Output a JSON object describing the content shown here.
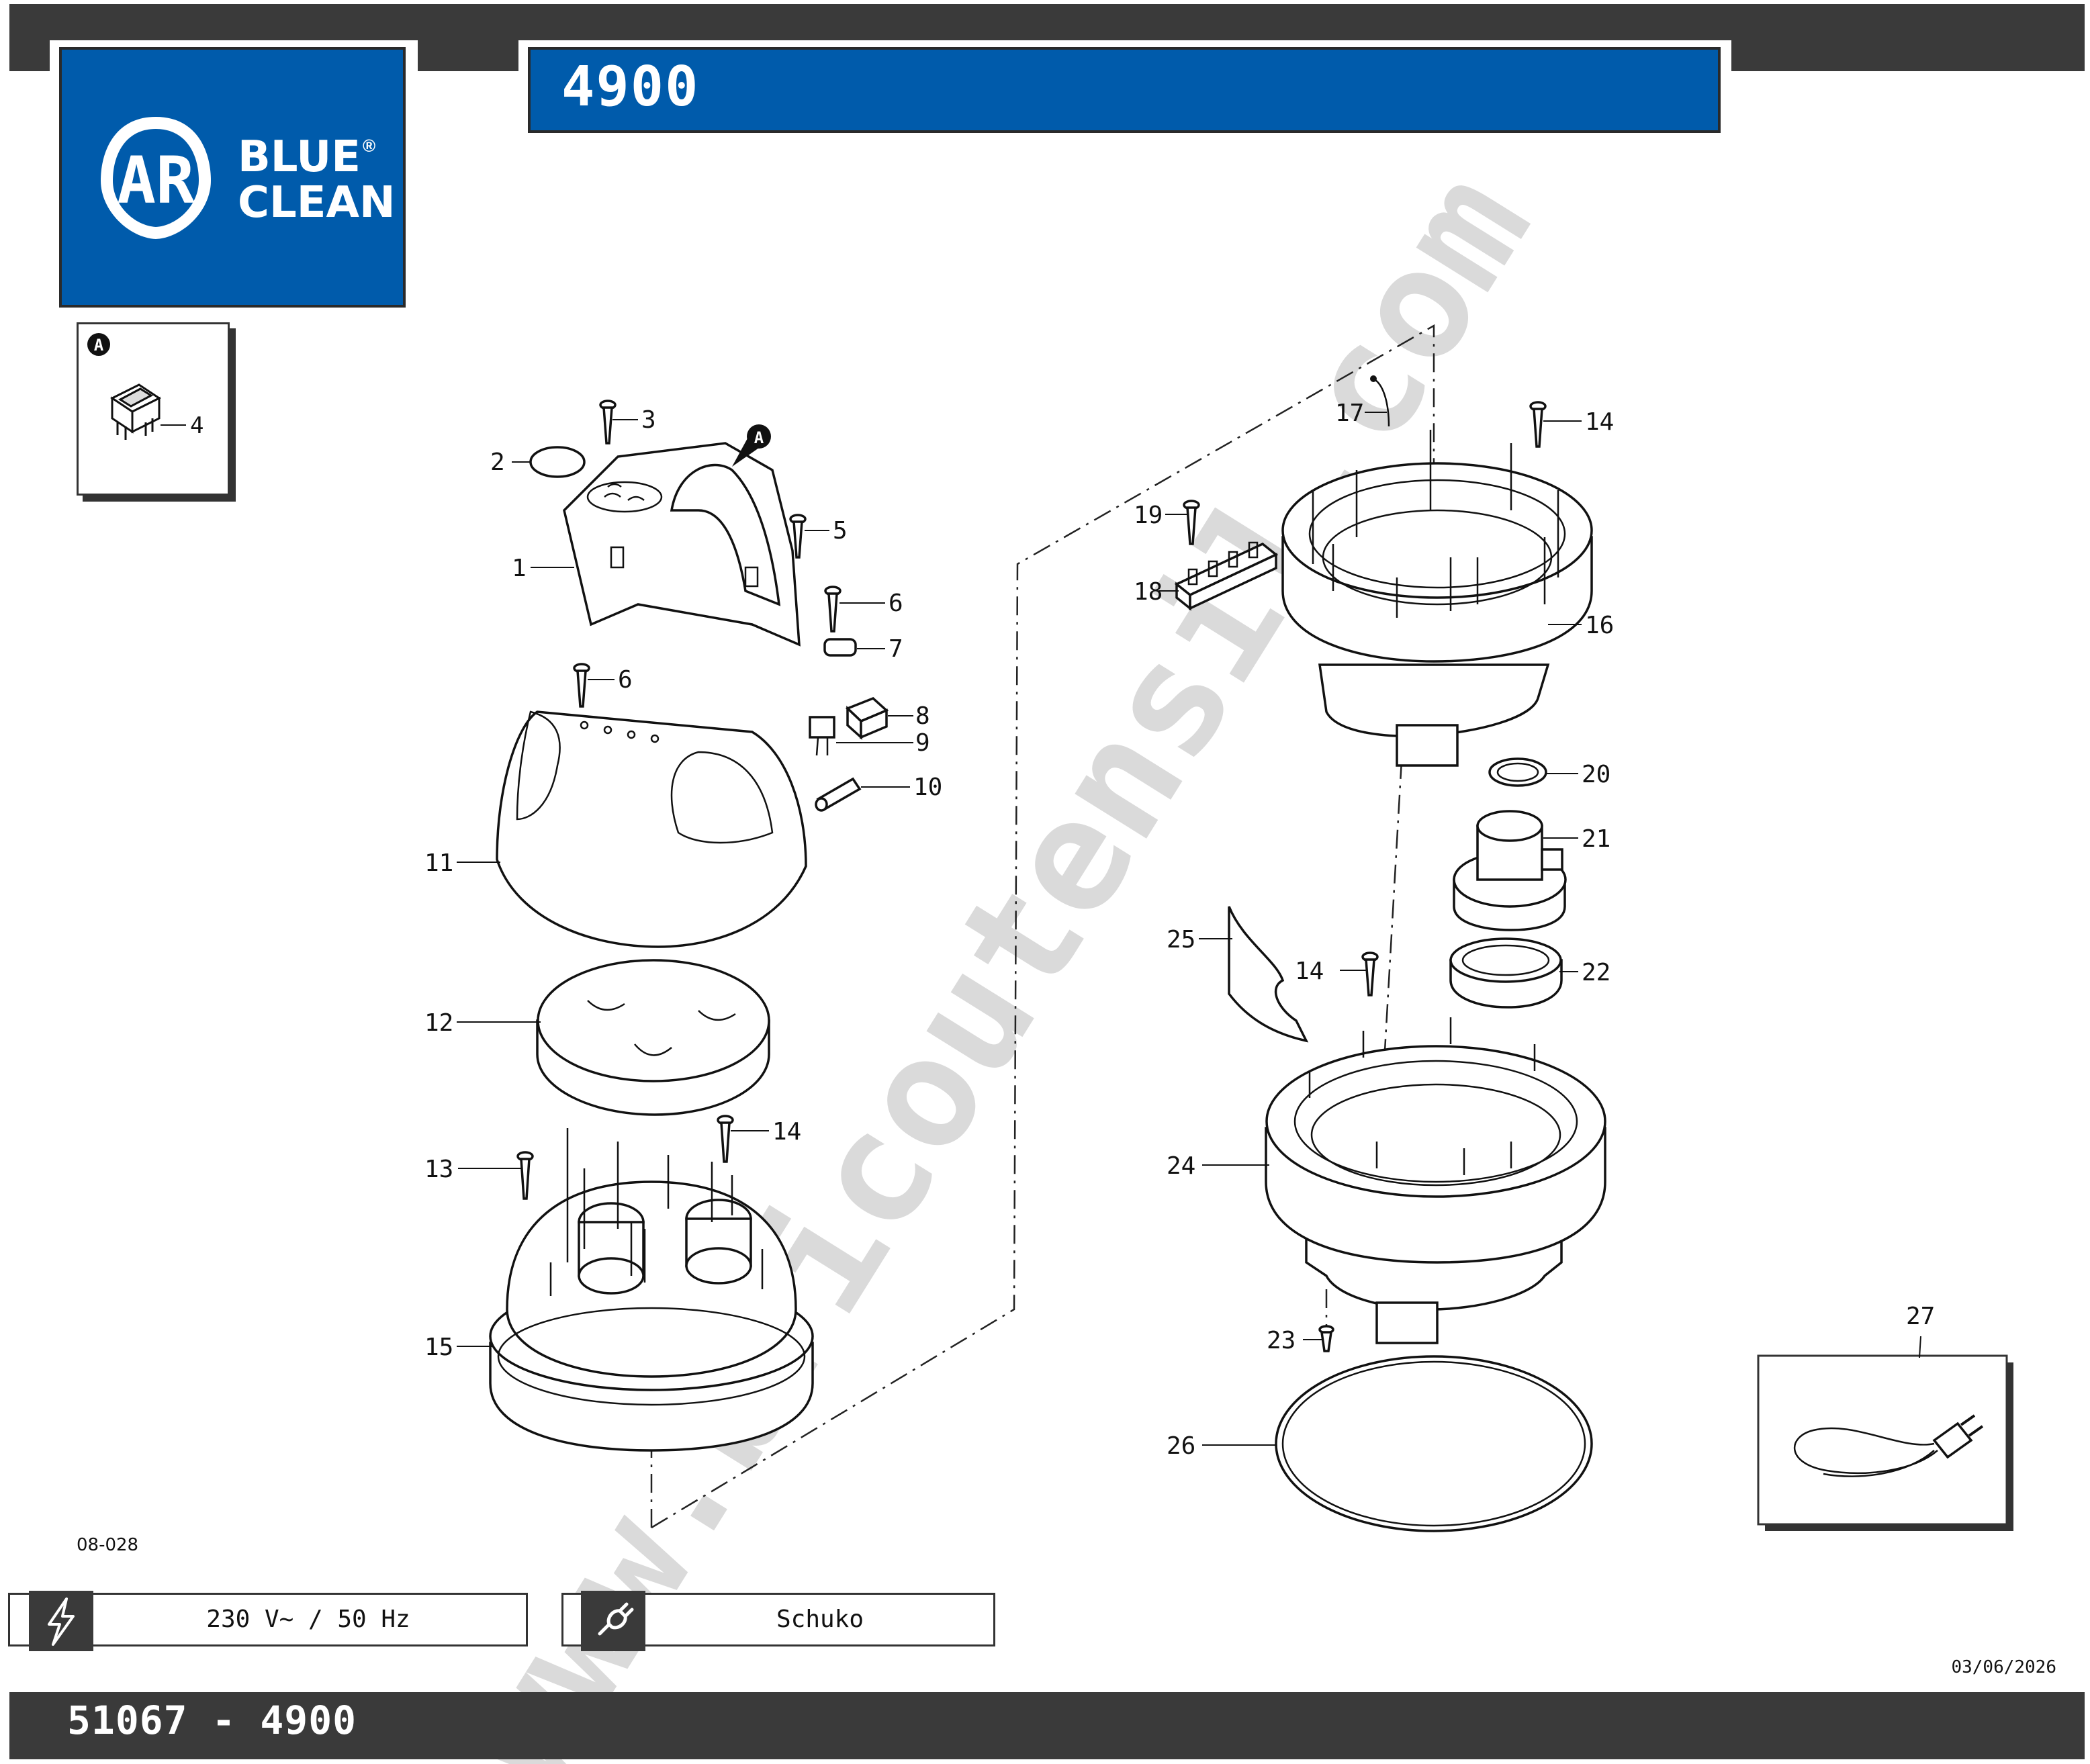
{
  "header": {
    "model_title": "4900"
  },
  "logo": {
    "line1": "BLUE",
    "line2": "CLEAN",
    "registered": "®",
    "monogram": "AR"
  },
  "inset_a": {
    "marker": "A",
    "callout": "4"
  },
  "diagram": {
    "drawing_code": "08-028",
    "watermark": "www.bricoutensil.com",
    "marker_a": "A",
    "callouts": {
      "c1": "1",
      "c2": "2",
      "c3": "3",
      "c5": "5",
      "c6a": "6",
      "c7": "7",
      "c6b": "6",
      "c8": "8",
      "c9": "9",
      "c10": "10",
      "c11": "11",
      "c12": "12",
      "c13": "13",
      "c14a": "14",
      "c15": "15",
      "c17": "17",
      "c14b": "14",
      "c19": "19",
      "c18": "18",
      "c16": "16",
      "c20": "20",
      "c21": "21",
      "c25": "25",
      "c14c": "14",
      "c22": "22",
      "c24": "24",
      "c23": "23",
      "c26": "26",
      "c27": "27"
    }
  },
  "specs": {
    "voltage": "230 V~ / 50 Hz",
    "plug": "Schuko"
  },
  "footer": {
    "code": "51067 - 4900",
    "date": "03/06/2026"
  }
}
